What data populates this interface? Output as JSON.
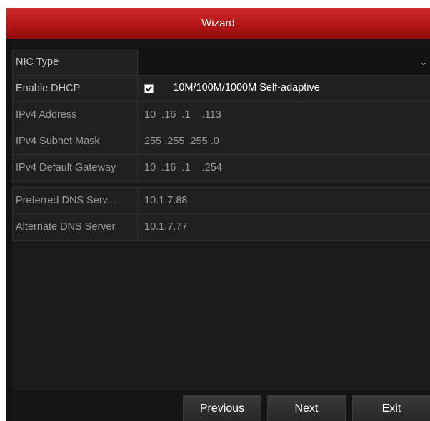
{
  "window": {
    "title": "Wizard"
  },
  "network": {
    "rows": [
      {
        "label": "NIC Type",
        "value": "10M/100M/1000M Self-adaptive"
      },
      {
        "label": "Enable DHCP",
        "checked": true
      },
      {
        "label": "IPv4 Address",
        "value": "10  .16  .1    .113"
      },
      {
        "label": "IPv4 Subnet Mask",
        "value": "255 .255 .255 .0"
      },
      {
        "label": "IPv4 Default Gateway",
        "value": "10  .16  .1    .254"
      }
    ],
    "dns": [
      {
        "label": "Preferred DNS Serv...",
        "value": "10.1.7.88"
      },
      {
        "label": "Alternate DNS Server",
        "value": "10.1.7.77"
      }
    ]
  },
  "footer": {
    "previous_label": "Previous",
    "next_label": "Next",
    "exit_label": "Exit"
  },
  "icons": {
    "nic_dropdown": "chevron-down-icon",
    "dhcp_checkbox": "checkmark-icon"
  },
  "colors": {
    "title_bar": "#b51616",
    "background": "#141414",
    "text_active": "#ffffff",
    "text_disabled": "#9a9a9a"
  }
}
